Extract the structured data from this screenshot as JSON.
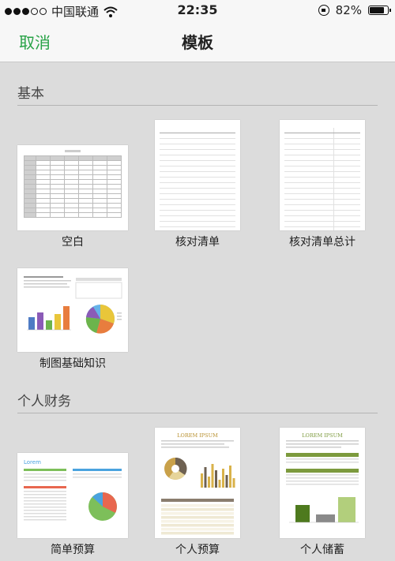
{
  "status": {
    "carrier": "中国联通",
    "time": "22:35",
    "battery": "82%",
    "battery_level": 0.82
  },
  "nav": {
    "cancel": "取消",
    "title": "模板"
  },
  "sections": [
    {
      "title": "基本",
      "items": [
        {
          "label": "空白",
          "thumb": "blank-sheet"
        },
        {
          "label": "核对清单",
          "thumb": "checklist"
        },
        {
          "label": "核对清单总计",
          "thumb": "checklist-total"
        },
        {
          "label": "制图基础知识",
          "thumb": "charting-basics"
        }
      ]
    },
    {
      "title": "个人财务",
      "items": [
        {
          "label": "简单预算",
          "thumb": "simple-budget"
        },
        {
          "label": "个人预算",
          "thumb": "personal-budget"
        },
        {
          "label": "个人储蓄",
          "thumb": "personal-savings"
        }
      ]
    }
  ],
  "thumb_text": {
    "lorem_small": "Lorem",
    "lorem_ipsum": "LOREM IPSUM"
  },
  "colors": {
    "accent": "#27a246",
    "bars": [
      "#4e7bc4",
      "#8b5bb7",
      "#6cb44c",
      "#e9c63a",
      "#e87d3e"
    ]
  }
}
